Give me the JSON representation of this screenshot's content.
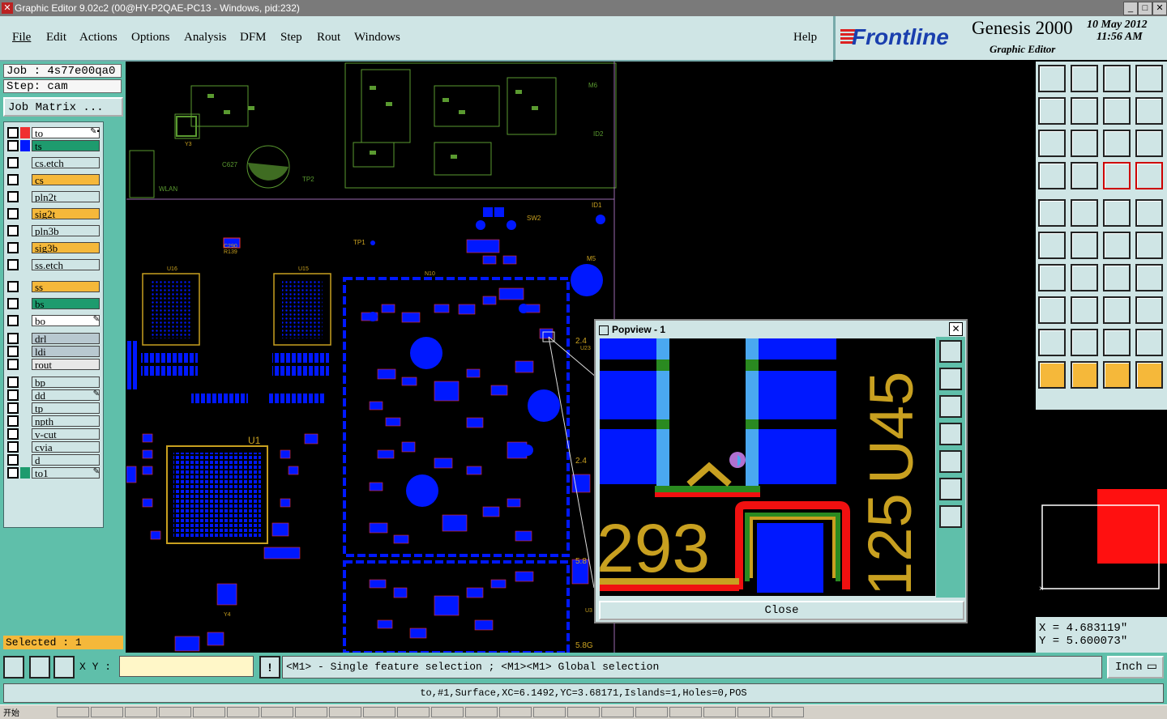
{
  "window": {
    "title": "Graphic Editor 9.02c2 (00@HY-P2QAE-PC13 - Windows, pid:232)"
  },
  "menu": {
    "items": [
      "File",
      "Edit",
      "Actions",
      "Options",
      "Analysis",
      "DFM",
      "Step",
      "Rout",
      "Windows"
    ],
    "help": "Help"
  },
  "brand": {
    "logo": "Frontline",
    "product": "Genesis 2000",
    "subtitle": "Graphic Editor",
    "date": "10 May 2012",
    "time": "11:56 AM"
  },
  "job": {
    "job_label": "Job : 4s77e00qa0",
    "step_label": "Step: cam",
    "matrix_button": "Job Matrix ..."
  },
  "layers": [
    {
      "name": "to",
      "color": "#ffffff",
      "mark": "✎▪"
    },
    {
      "name": "ts",
      "color": "#1e9b6e",
      "mark": ""
    },
    {
      "name": "cs.etch",
      "color": "#cfe5e5",
      "mark": ""
    },
    {
      "name": "cs",
      "color": "#f5b83a",
      "mark": ""
    },
    {
      "name": "pln2t",
      "color": "#cfe5e5",
      "mark": ""
    },
    {
      "name": "sig2t",
      "color": "#f5b83a",
      "mark": ""
    },
    {
      "name": "pln3b",
      "color": "#cfe5e5",
      "mark": ""
    },
    {
      "name": "sig3b",
      "color": "#f5b83a",
      "mark": ""
    },
    {
      "name": "ss.etch",
      "color": "#cfe5e5",
      "mark": ""
    },
    {
      "name": "ss",
      "color": "#f5b83a",
      "mark": ""
    },
    {
      "name": "bs",
      "color": "#1e9b6e",
      "mark": ""
    },
    {
      "name": "bo",
      "color": "#ffffff",
      "mark": "✎"
    },
    {
      "name": "drl",
      "color": "#b8c8d0",
      "mark": ""
    },
    {
      "name": "ldi",
      "color": "#b8c8d0",
      "mark": ""
    },
    {
      "name": "rout",
      "color": "#e8e8e8",
      "mark": ""
    },
    {
      "name": "bp",
      "color": "#cfe5e5",
      "mark": ""
    },
    {
      "name": "dd",
      "color": "#cfe5e5",
      "mark": "✎"
    },
    {
      "name": "tp",
      "color": "#cfe5e5",
      "mark": ""
    },
    {
      "name": "npth",
      "color": "#cfe5e5",
      "mark": ""
    },
    {
      "name": "v-cut",
      "color": "#cfe5e5",
      "mark": ""
    },
    {
      "name": "cvia",
      "color": "#cfe5e5",
      "mark": ""
    },
    {
      "name": "d",
      "color": "#cfe5e5",
      "mark": ""
    },
    {
      "name": "to1",
      "color": "#cfe5e5",
      "mark": "✎"
    }
  ],
  "selected_label": "Selected : 1",
  "canvas_labels": {
    "u16": "U16",
    "u15": "U15",
    "u1": "U1",
    "m5": "M5",
    "m6": "M6",
    "id1": "ID1",
    "id2": "ID2",
    "tp1": "TP1",
    "tp2": "TP2",
    "sw2": "SW2",
    "c627": "C627",
    "c290": "C290",
    "r139": "R139",
    "n10": "N10",
    "y3": "Y3",
    "y4": "Y4",
    "wlan": "WLAN",
    "d28": "2.4",
    "d29": "2.4",
    "d58": "5.8",
    "d58g": "5.8G",
    "u3": "U3",
    "u23": "U23"
  },
  "popview": {
    "title": "Popview - 1",
    "close_label": "Close",
    "text_293": "293",
    "text_u45": "U45",
    "text_125": "125"
  },
  "coords": {
    "x": "X = 4.683119\"",
    "y": "Y = 5.600073\""
  },
  "status": {
    "xy_label": "X Y :",
    "xy_value": "",
    "message": "<M1> - Single feature selection ; <M1><M1> Global selection",
    "unit": "Inch",
    "info": "to,#1,Surface,XC=6.1492,YC=3.68171,Islands=1,Holes=0,POS"
  },
  "taskbar": {
    "start": "开始"
  },
  "colors": {
    "accent": "#cfe5e5",
    "panel": "#5fbfaa",
    "copper": "#0018ff",
    "silk": "#c8a020"
  }
}
